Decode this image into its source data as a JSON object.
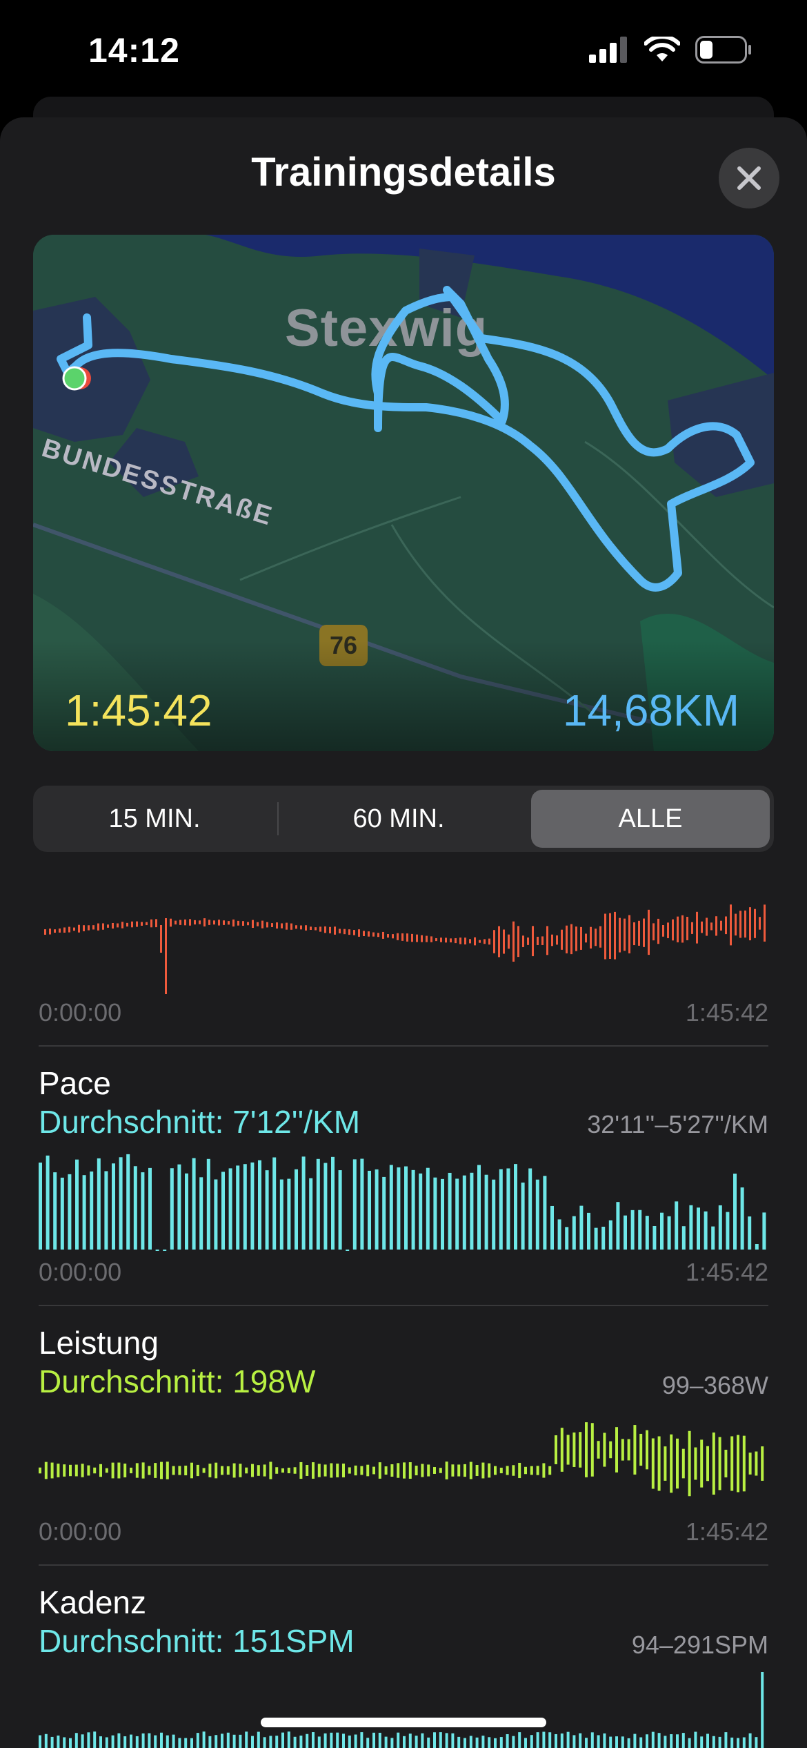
{
  "status_bar": {
    "time": "14:12",
    "signal": "cellular-signal-icon",
    "wifi": "wifi-icon",
    "battery": "battery-icon"
  },
  "sheet": {
    "title": "Trainingsdetails",
    "close_icon": "close-icon"
  },
  "map": {
    "city_label": "Stexwig",
    "road_label": "BUNDESSTRAßE",
    "road_number": "76",
    "duration": "1:45:42",
    "distance": "14,68KM",
    "route_color": "#5ab8f5"
  },
  "range_selector": {
    "options": [
      "15 MIN.",
      "60 MIN.",
      "ALLE"
    ],
    "selected": "ALLE"
  },
  "charts": [
    {
      "id": "heart",
      "name": "",
      "average": "",
      "range": "",
      "start": "0:00:00",
      "end": "1:45:42",
      "color": "#ef5a3c"
    },
    {
      "id": "pace",
      "name": "Pace",
      "average": "Durchschnitt: 7'12''/KM",
      "range": "32'11''–5'27''/KM",
      "start": "0:00:00",
      "end": "1:45:42",
      "color": "#6ee7e8"
    },
    {
      "id": "power",
      "name": "Leistung",
      "average": "Durchschnitt: 198W",
      "range": "99–368W",
      "start": "0:00:00",
      "end": "1:45:42",
      "color": "#b8f042"
    },
    {
      "id": "cadence",
      "name": "Kadenz",
      "average": "Durchschnitt: 151SPM",
      "range": "94–291SPM",
      "start": "",
      "end": "",
      "color": "#6ee7e8"
    }
  ]
}
